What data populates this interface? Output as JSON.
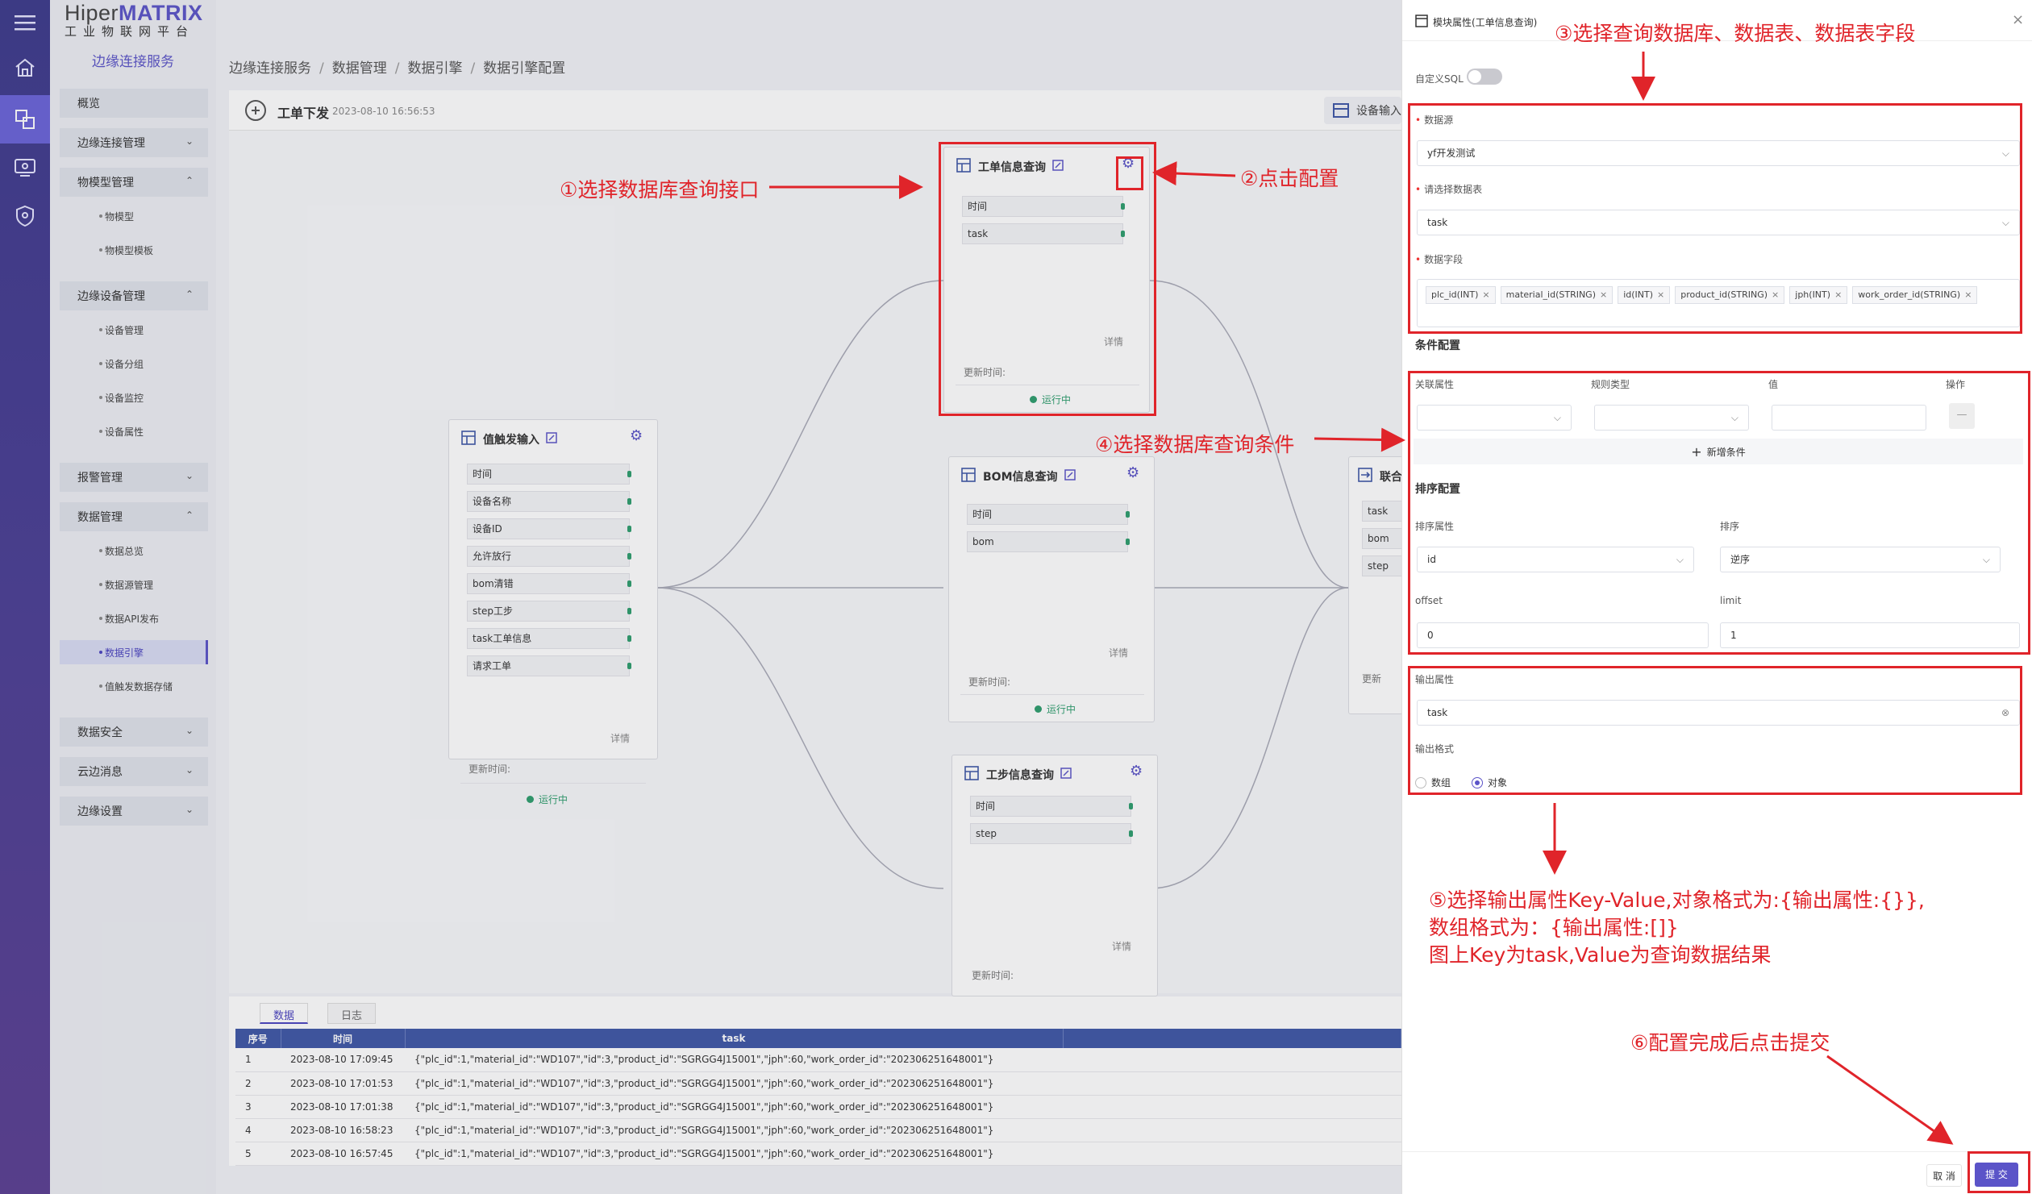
{
  "iconbar": {
    "icons": [
      "menu-icon",
      "home-icon",
      "flow-icon",
      "monitor-icon",
      "shield-icon"
    ]
  },
  "logo": {
    "brand_a": "Hiper",
    "brand_b": "MATRIX",
    "subtitle": "工业物联网平台"
  },
  "sidebar": {
    "title": "边缘连接服务",
    "items": [
      {
        "type": "menu",
        "label": "概览"
      },
      {
        "type": "menu",
        "label": "边缘连接管理",
        "chev": "⌄"
      },
      {
        "type": "menu",
        "label": "物模型管理",
        "chev": "⌃"
      },
      {
        "type": "sub",
        "label": "物模型"
      },
      {
        "type": "sub",
        "label": "物模型模板"
      },
      {
        "type": "menu",
        "label": "边缘设备管理",
        "chev": "⌃"
      },
      {
        "type": "sub",
        "label": "设备管理"
      },
      {
        "type": "sub",
        "label": "设备分组"
      },
      {
        "type": "sub",
        "label": "设备监控"
      },
      {
        "type": "sub",
        "label": "设备属性"
      },
      {
        "type": "menu",
        "label": "报警管理",
        "chev": "⌄"
      },
      {
        "type": "menu",
        "label": "数据管理",
        "chev": "⌃"
      },
      {
        "type": "sub",
        "label": "数据总览"
      },
      {
        "type": "sub",
        "label": "数据源管理"
      },
      {
        "type": "sub",
        "label": "数据API发布"
      },
      {
        "type": "sub",
        "label": "数据引擎",
        "active": true
      },
      {
        "type": "sub",
        "label": "值触发数据存储"
      },
      {
        "type": "menu",
        "label": "数据安全",
        "chev": "⌄"
      },
      {
        "type": "menu",
        "label": "云边消息",
        "chev": "⌄"
      },
      {
        "type": "menu",
        "label": "边缘设置",
        "chev": "⌄"
      }
    ]
  },
  "breadcrumb": [
    "边缘连接服务",
    "数据管理",
    "数据引擎",
    "数据引擎配置"
  ],
  "flow": {
    "name": "工单下发",
    "time": "2023-08-10 16:56:53",
    "input_btn": "设备输入"
  },
  "nodes": {
    "trigger": {
      "title": "值触发输入",
      "fields": [
        "时间",
        "设备名称",
        "设备ID",
        "允许放行",
        "bom清错",
        "step工步",
        "task工单信息",
        "请求工单"
      ],
      "detail": "详情",
      "update": "更新时间:",
      "status": "运行中"
    },
    "workorder": {
      "title": "工单信息查询",
      "fields": [
        "时间",
        "task"
      ],
      "detail": "详情",
      "update": "更新时间:",
      "status": "运行中"
    },
    "bom": {
      "title": "BOM信息查询",
      "fields": [
        "时间",
        "bom"
      ],
      "detail": "详情",
      "update": "更新时间:",
      "status": "运行中"
    },
    "step": {
      "title": "工步信息查询",
      "fields": [
        "时间",
        "step"
      ],
      "detail": "详情",
      "update": "更新时间:"
    },
    "merge": {
      "title": "联合",
      "fields": [
        "task",
        "bom",
        "step"
      ],
      "update": "更新"
    }
  },
  "bottom": {
    "tabs": [
      "数据",
      "日志"
    ],
    "columns": [
      "序号",
      "时间",
      "task"
    ],
    "rows": [
      [
        "1",
        "2023-08-10 17:09:45",
        "{\"plc_id\":1,\"material_id\":\"WD107\",\"id\":3,\"product_id\":\"SGRGG4J15001\",\"jph\":60,\"work_order_id\":\"202306251648001\"}"
      ],
      [
        "2",
        "2023-08-10 17:01:53",
        "{\"plc_id\":1,\"material_id\":\"WD107\",\"id\":3,\"product_id\":\"SGRGG4J15001\",\"jph\":60,\"work_order_id\":\"202306251648001\"}"
      ],
      [
        "3",
        "2023-08-10 17:01:38",
        "{\"plc_id\":1,\"material_id\":\"WD107\",\"id\":3,\"product_id\":\"SGRGG4J15001\",\"jph\":60,\"work_order_id\":\"202306251648001\"}"
      ],
      [
        "4",
        "2023-08-10 16:58:23",
        "{\"plc_id\":1,\"material_id\":\"WD107\",\"id\":3,\"product_id\":\"SGRGG4J15001\",\"jph\":60,\"work_order_id\":\"202306251648001\"}"
      ],
      [
        "5",
        "2023-08-10 16:57:45",
        "{\"plc_id\":1,\"material_id\":\"WD107\",\"id\":3,\"product_id\":\"SGRGG4J15001\",\"jph\":60,\"work_order_id\":\"202306251648001\"}"
      ]
    ]
  },
  "drawer": {
    "title": "模块属性(工单信息查询)",
    "close": "×",
    "custom_sql": "自定义SQL",
    "datasource_label": "数据源",
    "datasource_value": "yf开发测试",
    "table_label": "请选择数据表",
    "table_value": "task",
    "fields_label": "数据字段",
    "field_tags": [
      "plc_id(INT)",
      "material_id(STRING)",
      "id(INT)",
      "product_id(STRING)",
      "jph(INT)",
      "work_order_id(STRING)"
    ],
    "cond_section": "条件配置",
    "cond_cols": [
      "关联属性",
      "规则类型",
      "值",
      "操作"
    ],
    "cond_remove": "—",
    "add_cond": "新增条件",
    "sort_section": "排序配置",
    "sort_attr_label": "排序属性",
    "sort_attr_value": "id",
    "sort_order_label": "排序",
    "sort_order_value": "逆序",
    "offset_label": "offset",
    "offset_value": "0",
    "limit_label": "limit",
    "limit_value": "1",
    "output_attr_label": "输出属性",
    "output_attr_value": "task",
    "output_format_label": "输出格式",
    "format_array": "数组",
    "format_object": "对象",
    "cancel": "取 消",
    "submit": "提 交"
  },
  "annotations": {
    "a1": "①选择数据库查询接口",
    "a2": "②点击配置",
    "a3": "③选择查询数据库、数据表、数据表字段",
    "a4": "④选择数据库查询条件",
    "a5_l1": "⑤选择输出属性Key-Value,对象格式为:{输出属性:{}},",
    "a5_l2": "数组格式为：{输出属性:[]}",
    "a5_l3": "图上Key为task,Value为查询数据结果",
    "a6": "⑥配置完成后点击提交"
  },
  "colors": {
    "accent": "#5b54c8",
    "annotation": "#e0242a",
    "running": "#2e9e6e"
  }
}
